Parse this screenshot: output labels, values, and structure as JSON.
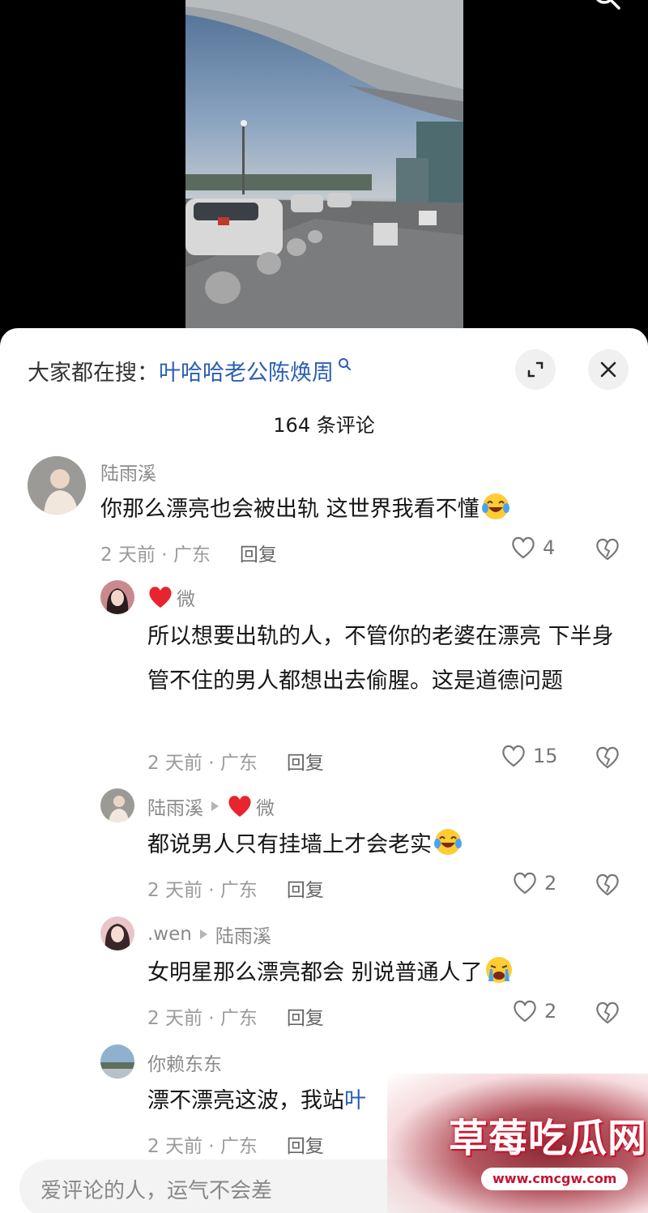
{
  "header": {
    "trending_prefix": "大家都在搜：",
    "trending_query": "叶哈哈老公陈焕周"
  },
  "comment_count": "164 条评论",
  "comments": [
    {
      "author": "陆雨溪",
      "text": "你那么漂亮也会被出轨 这世界我看不懂",
      "emoji": "laughing-tears-emoji",
      "time_location": "2 天前 · 广东",
      "reply_label": "回复",
      "likes": "4"
    },
    {
      "author": "微",
      "author_badge": "red-heart-icon",
      "text": "所以想要出轨的人，不管你的老婆在漂亮 下半身管不住的男人都想出去偷腥。这是道德问题",
      "time_location": "2 天前 · 广东",
      "reply_label": "回复",
      "likes": "15"
    },
    {
      "author": "陆雨溪",
      "reply_to": "微",
      "text": "都说男人只有挂墙上才会老实",
      "emoji": "laughing-tears-emoji",
      "time_location": "2 天前 · 广东",
      "reply_label": "回复",
      "likes": "2"
    },
    {
      "author": ".wen",
      "reply_to": "陆雨溪",
      "text": "女明星那么漂亮都会 别说普通人了",
      "emoji": "crying-emoji",
      "time_location": "2 天前 · 广东",
      "reply_label": "回复",
      "likes": "2"
    },
    {
      "author": "你赖东东",
      "text": "漂不漂亮这波，我站",
      "text_link": "叶",
      "time_location": "2 天前 · 广东",
      "reply_label": "回复"
    }
  ],
  "input": {
    "placeholder": "爱评论的人，运气不会差"
  },
  "watermark": {
    "title": "草莓吃瓜网",
    "url": "www.cmcgw.com"
  },
  "colors": {
    "link": "#2b5fb4",
    "heart": "#e8242f",
    "watermark_red": "#c31432"
  }
}
